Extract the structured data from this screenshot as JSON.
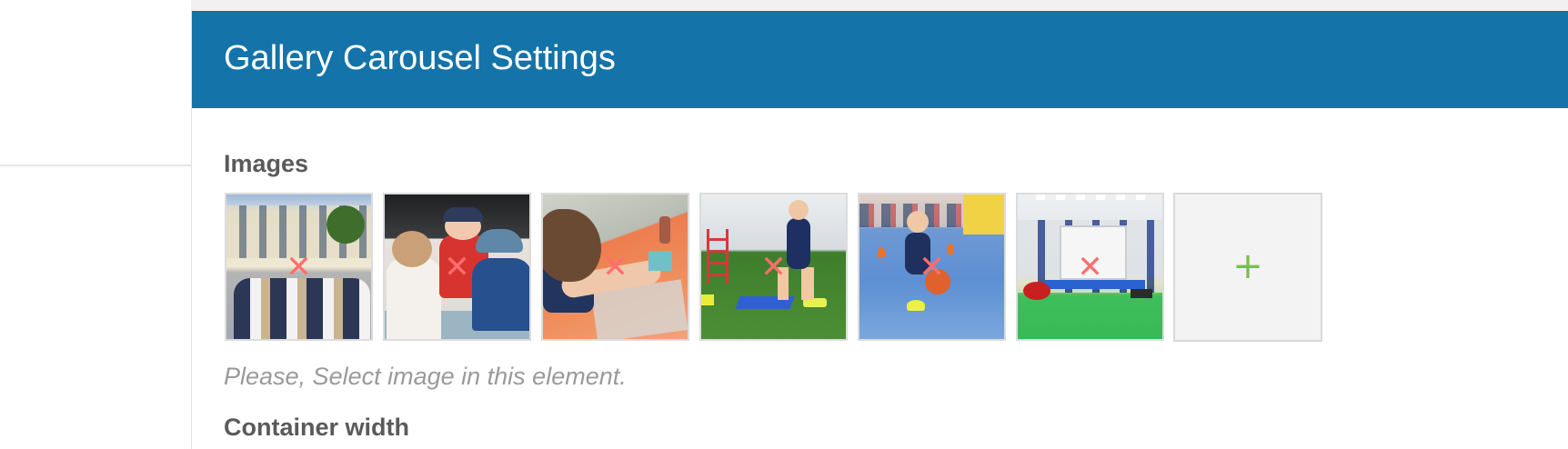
{
  "panel": {
    "title": "Gallery Carousel Settings",
    "header_color": "#1473a8"
  },
  "images_section": {
    "label": "Images",
    "thumbnails": [
      {
        "icon": "photo-icon",
        "remove_glyph": "✕",
        "remove_icon": "close-icon"
      },
      {
        "icon": "photo-icon",
        "remove_glyph": "✕",
        "remove_icon": "close-icon"
      },
      {
        "icon": "photo-icon",
        "remove_glyph": "✕",
        "remove_icon": "close-icon"
      },
      {
        "icon": "photo-icon",
        "remove_glyph": "✕",
        "remove_icon": "close-icon"
      },
      {
        "icon": "photo-icon",
        "remove_glyph": "✕",
        "remove_icon": "close-icon"
      },
      {
        "icon": "photo-icon",
        "remove_glyph": "✕",
        "remove_icon": "close-icon"
      }
    ],
    "add_button": {
      "glyph": "+",
      "icon": "plus-icon",
      "accent_color": "#79c14b"
    },
    "hint": "Please, Select image in this element."
  },
  "container_width_section": {
    "label": "Container width"
  },
  "colors": {
    "remove_icon": "#ff6e6e",
    "label_text": "#5a5a5a",
    "hint_text": "#9a9a9a"
  }
}
